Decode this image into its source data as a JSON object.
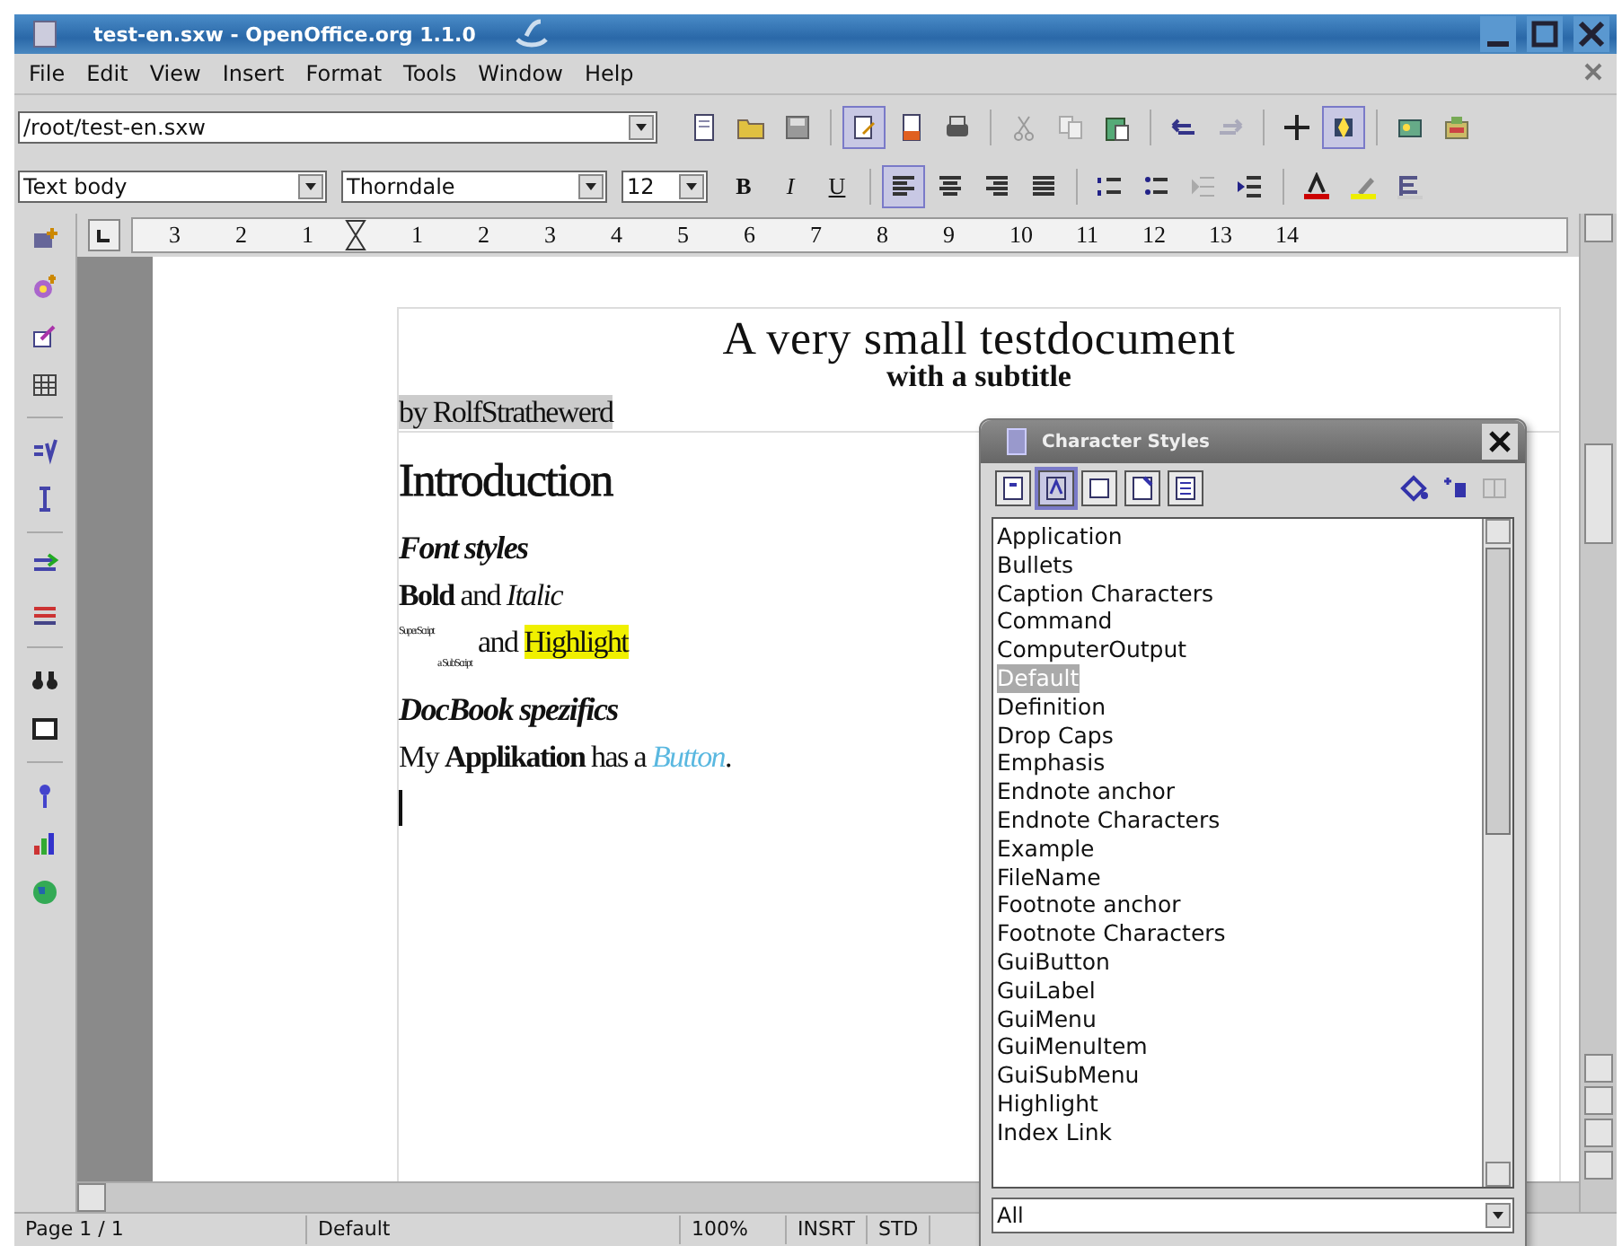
{
  "window": {
    "title": "test-en.sxw - OpenOffice.org 1.1.0"
  },
  "menu": [
    "File",
    "Edit",
    "View",
    "Insert",
    "Format",
    "Tools",
    "Window",
    "Help"
  ],
  "function_bar": {
    "url": "/root/test-en.sxw",
    "buttons": [
      {
        "kind": "new",
        "selected": false
      },
      {
        "kind": "open",
        "selected": false
      },
      {
        "kind": "save",
        "selected": false
      },
      {
        "kind": "edit",
        "selected": true
      },
      {
        "kind": "pdf",
        "selected": false
      },
      {
        "kind": "print",
        "selected": false
      },
      {
        "kind": "cut",
        "selected": false
      },
      {
        "kind": "copy",
        "selected": false
      },
      {
        "kind": "paste",
        "selected": false
      },
      {
        "kind": "undo",
        "selected": false
      },
      {
        "kind": "redo",
        "selected": false
      },
      {
        "kind": "cross",
        "selected": false
      },
      {
        "kind": "navigator",
        "selected": true
      },
      {
        "kind": "gallery",
        "selected": false
      },
      {
        "kind": "datasource",
        "selected": false
      }
    ]
  },
  "object_bar": {
    "style": "Text body",
    "font": "Thorndale",
    "size": "12",
    "buttons": [
      {
        "kind": "char",
        "text": "B",
        "selected": false
      },
      {
        "kind": "char",
        "text": "I",
        "selected": false
      },
      {
        "kind": "char",
        "text": "U",
        "selected": false
      },
      {
        "kind": "align-left",
        "selected": true
      },
      {
        "kind": "align-center",
        "selected": false
      },
      {
        "kind": "align-right",
        "selected": false
      },
      {
        "kind": "justify",
        "selected": false
      },
      {
        "kind": "numbering",
        "selected": false
      },
      {
        "kind": "bullets",
        "selected": false
      },
      {
        "kind": "outdent",
        "selected": false
      },
      {
        "kind": "indent",
        "selected": false
      },
      {
        "kind": "font-color",
        "selected": false
      },
      {
        "kind": "highlight",
        "selected": false
      },
      {
        "kind": "background",
        "selected": false
      }
    ]
  },
  "ruler": {
    "left_labels": [
      "3",
      "2",
      "1"
    ],
    "right_labels": [
      "1",
      "2",
      "3",
      "4",
      "5",
      "6",
      "7",
      "8",
      "9",
      "10",
      "11",
      "12",
      "13",
      "14"
    ]
  },
  "document": {
    "title": "A very small testdocument",
    "subtitle": "with a subtitle",
    "author": "by RolfStrathewerd",
    "blocks": [
      {
        "kind": "heading1",
        "parts": [
          {
            "kind": "plain",
            "text": "Introduction"
          }
        ]
      },
      {
        "kind": "heading2",
        "parts": [
          {
            "kind": "plain",
            "text": "Font styles"
          }
        ]
      },
      {
        "kind": "body",
        "parts": [
          {
            "kind": "bold",
            "text": "Bold"
          },
          {
            "kind": "plain",
            "text": " and "
          },
          {
            "kind": "italic",
            "text": "Italic"
          }
        ]
      },
      {
        "kind": "body",
        "parts": [
          {
            "kind": "sup",
            "text": "SuperScript"
          },
          {
            "kind": "sub",
            "text": "a SubScript"
          },
          {
            "kind": "plain",
            "text": " and "
          },
          {
            "kind": "highlight",
            "text": "Highlight"
          }
        ]
      },
      {
        "kind": "heading2",
        "parts": [
          {
            "kind": "plain",
            "text": "DocBook spezifics"
          }
        ]
      },
      {
        "kind": "body",
        "parts": [
          {
            "kind": "plain",
            "text": "My "
          },
          {
            "kind": "bold",
            "text": "Applikation"
          },
          {
            "kind": "plain",
            "text": " has a "
          },
          {
            "kind": "button",
            "text": "Button"
          },
          {
            "kind": "plain",
            "text": "."
          }
        ]
      }
    ]
  },
  "stylist": {
    "title": "Character Styles",
    "families": [
      {
        "selected": false
      },
      {
        "selected": true
      },
      {
        "selected": false
      },
      {
        "selected": false
      },
      {
        "selected": false
      }
    ],
    "styles": [
      {
        "name": "Application",
        "selected": false
      },
      {
        "name": "Bullets",
        "selected": false
      },
      {
        "name": "Caption Characters",
        "selected": false
      },
      {
        "name": "Command",
        "selected": false
      },
      {
        "name": "ComputerOutput",
        "selected": false
      },
      {
        "name": "Default",
        "selected": true
      },
      {
        "name": "Definition",
        "selected": false
      },
      {
        "name": "Drop Caps",
        "selected": false
      },
      {
        "name": "Emphasis",
        "selected": false
      },
      {
        "name": "Endnote anchor",
        "selected": false
      },
      {
        "name": "Endnote Characters",
        "selected": false
      },
      {
        "name": "Example",
        "selected": false
      },
      {
        "name": "FileName",
        "selected": false
      },
      {
        "name": "Footnote anchor",
        "selected": false
      },
      {
        "name": "Footnote Characters",
        "selected": false
      },
      {
        "name": "GuiButton",
        "selected": false
      },
      {
        "name": "GuiLabel",
        "selected": false
      },
      {
        "name": "GuiMenu",
        "selected": false
      },
      {
        "name": "GuiMenuItem",
        "selected": false
      },
      {
        "name": "GuiSubMenu",
        "selected": false
      },
      {
        "name": "Highlight",
        "selected": false
      },
      {
        "name": "Index Link",
        "selected": false
      }
    ],
    "filter": "All"
  },
  "status_bar": {
    "page": "Page 1 / 1",
    "page_style": "Default",
    "zoom": "100%",
    "insert_mode": "INSRT",
    "selection_mode": "STD"
  }
}
